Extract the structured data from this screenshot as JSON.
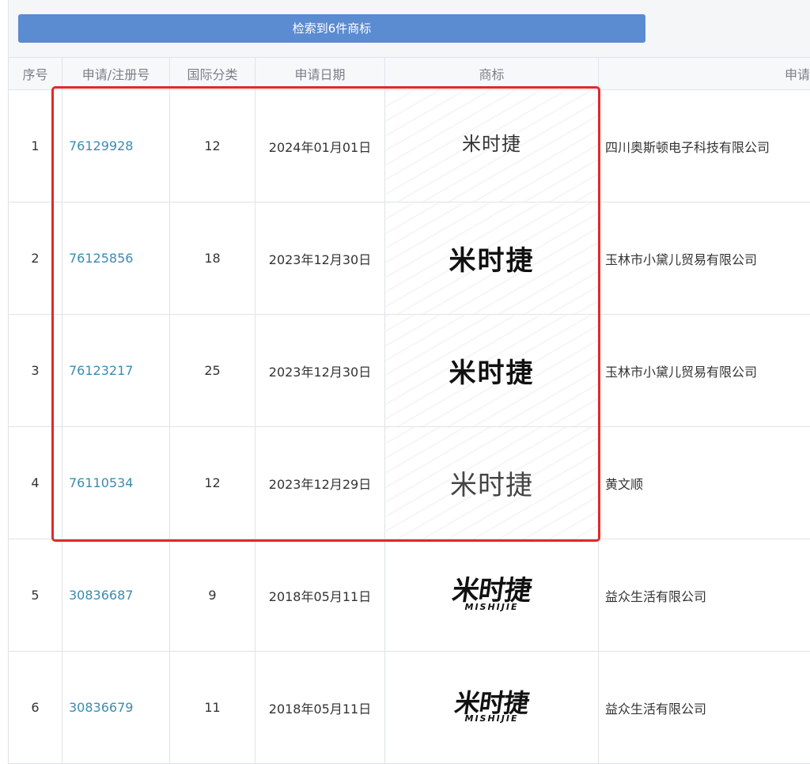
{
  "banner": {
    "label": "检索到6件商标"
  },
  "columns": {
    "seq": "序号",
    "app_no": "申请/注册号",
    "intl_class": "国际分类",
    "app_date": "申请日期",
    "mark": "商标",
    "applicant": "申请"
  },
  "rows": [
    {
      "seq": "1",
      "app_no": "76129928",
      "intl_class": "12",
      "app_date": "2024年01月01日",
      "mark": "米时捷",
      "applicant": "四川奥斯顿电子科技有限公司"
    },
    {
      "seq": "2",
      "app_no": "76125856",
      "intl_class": "18",
      "app_date": "2023年12月30日",
      "mark": "米时捷",
      "applicant": "玉林市小黛儿贸易有限公司"
    },
    {
      "seq": "3",
      "app_no": "76123217",
      "intl_class": "25",
      "app_date": "2023年12月30日",
      "mark": "米时捷",
      "applicant": "玉林市小黛儿贸易有限公司"
    },
    {
      "seq": "4",
      "app_no": "76110534",
      "intl_class": "12",
      "app_date": "2023年12月29日",
      "mark": "米时捷",
      "applicant": "黄文顺"
    },
    {
      "seq": "5",
      "app_no": "30836687",
      "intl_class": "9",
      "app_date": "2018年05月11日",
      "mark": "米时捷",
      "mark_sub": "MISHIJIE",
      "applicant": "益众生活有限公司"
    },
    {
      "seq": "6",
      "app_no": "30836679",
      "intl_class": "11",
      "app_date": "2018年05月11日",
      "mark": "米时捷",
      "mark_sub": "MISHIJIE",
      "applicant": "益众生活有限公司"
    }
  ],
  "colors": {
    "banner": "#5b8bd0",
    "link": "#3a8bb0",
    "highlight": "#e02a2a"
  }
}
